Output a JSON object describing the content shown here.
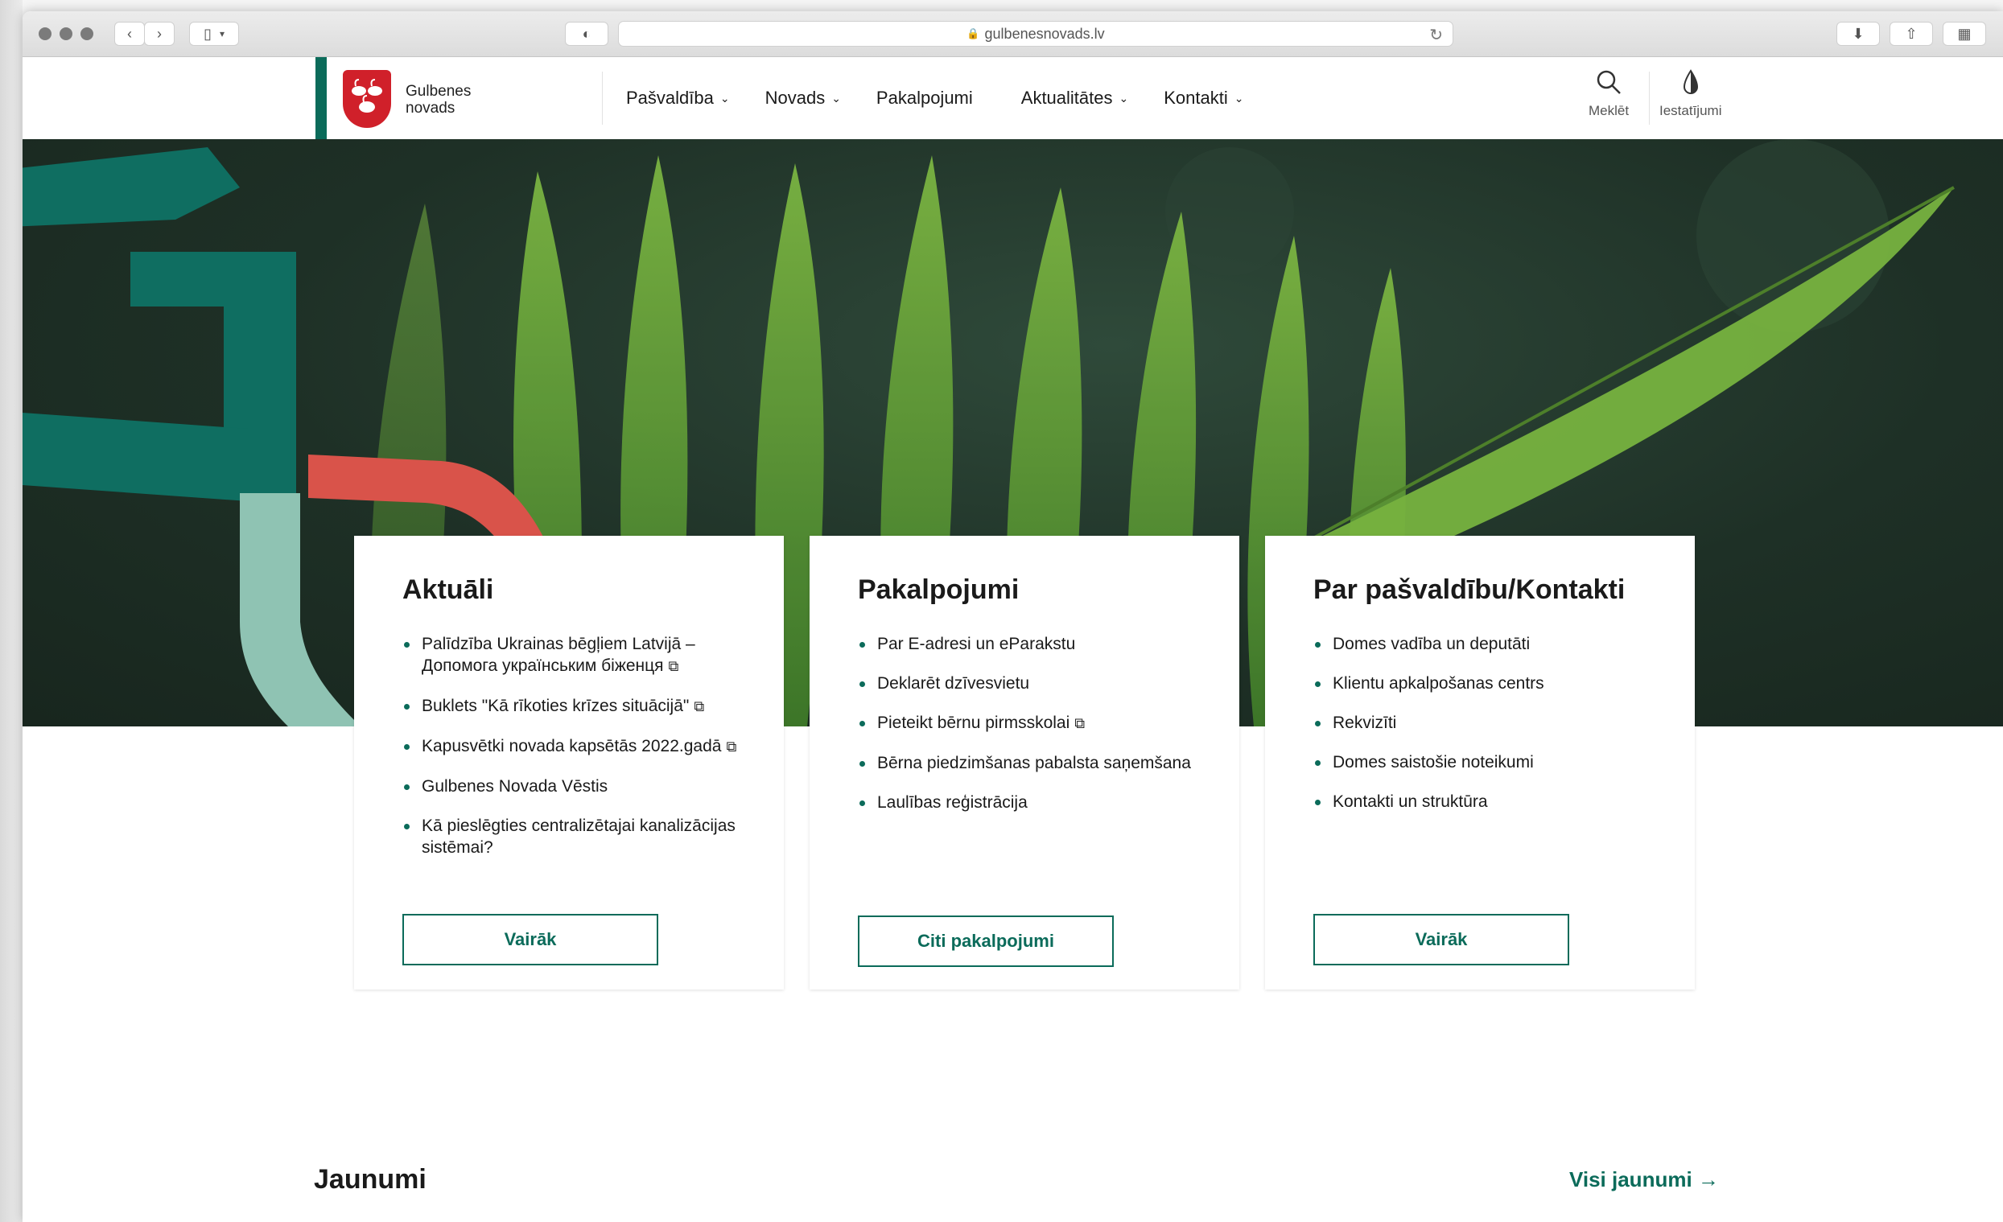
{
  "browser": {
    "url": "gulbenesnovads.lv"
  },
  "header": {
    "brand_line1": "Gulbenes",
    "brand_line2": "novads",
    "nav": [
      {
        "label": "Pašvaldība",
        "has_dropdown": true
      },
      {
        "label": "Novads",
        "has_dropdown": true
      },
      {
        "label": "Pakalpojumi",
        "has_dropdown": false
      },
      {
        "label": "Aktualitātes",
        "has_dropdown": true
      },
      {
        "label": "Kontakti",
        "has_dropdown": true
      }
    ],
    "search_label": "Meklēt",
    "settings_label": "Iestatījumi"
  },
  "cards": [
    {
      "title": "Aktuāli",
      "items": [
        {
          "text": "Palīdzība Ukrainas bēgļiem Latvijā – Допомога українським біженця",
          "external": true
        },
        {
          "text": "Buklets \"Kā rīkoties krīzes situācijā\"",
          "external": true
        },
        {
          "text": "Kapusvētki novada kapsētās 2022.gadā",
          "external": true
        },
        {
          "text": "Gulbenes Novada Vēstis",
          "external": false
        },
        {
          "text": "Kā pieslēgties centralizētajai kanalizācijas sistēmai?",
          "external": false
        }
      ],
      "button": "Vairāk"
    },
    {
      "title": "Pakalpojumi",
      "items": [
        {
          "text": "Par E-adresi un eParakstu",
          "external": false
        },
        {
          "text": "Deklarēt dzīvesvietu",
          "external": false
        },
        {
          "text": "Pieteikt bērnu pirmsskolai",
          "external": true
        },
        {
          "text": "Bērna piedzimšanas pabalsta saņemšana",
          "external": false
        },
        {
          "text": "Laulības reģistrācija",
          "external": false
        }
      ],
      "button": "Citi pakalpojumi"
    },
    {
      "title": "Par pašvaldību/Kontakti",
      "items": [
        {
          "text": "Domes vadība un deputāti",
          "external": false
        },
        {
          "text": "Klientu apkalpošanas centrs",
          "external": false
        },
        {
          "text": "Rekvizīti",
          "external": false
        },
        {
          "text": "Domes saistošie noteikumi",
          "external": false
        },
        {
          "text": "Kontakti un struktūra",
          "external": false
        }
      ],
      "button": "Vairāk"
    }
  ],
  "news": {
    "title": "Jaunumi",
    "all_link": "Visi jaunumi →"
  },
  "colors": {
    "accent": "#0b6b5a",
    "crest_red": "#d0202a",
    "hero_dark": "#1e3026",
    "fern_green": "#6da83a",
    "shape_teal": "#0f6e61",
    "shape_light": "#8fc3b3",
    "shape_red": "#d9534a"
  }
}
